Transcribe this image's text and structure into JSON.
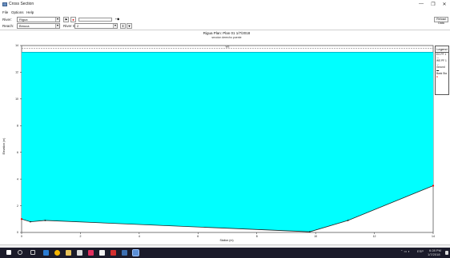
{
  "window": {
    "title": "Cross Section",
    "minimize": "—",
    "maximize": "❐",
    "close": "✕"
  },
  "menu": [
    "File",
    "Options",
    "Help"
  ],
  "toolbar": {
    "river_label": "River:",
    "river_value": "Rigua",
    "reach_label": "Reach:",
    "reach_value": "Bmuca",
    "station_label": "River Sta.:",
    "station_value": "2",
    "reload_label": "Reload Data"
  },
  "chart_data": {
    "type": "area",
    "title": "Rigua     Plan: Plan 01     1/7/2018",
    "subtitle": "seccion derecho puente",
    "xlabel": "Station (m)",
    "ylabel": "Elevation (m)",
    "xlim": [
      0,
      14
    ],
    "ylim": [
      0,
      14
    ],
    "xticks": [
      "0",
      "2",
      "4",
      "6",
      "8",
      "10",
      "12",
      "14"
    ],
    "yticks": [
      "0",
      "2",
      "4",
      "6",
      "8",
      "10",
      "12",
      "14"
    ],
    "water_surface_elevation": 13.5,
    "water_label": "WS",
    "ground": {
      "x": [
        0,
        0.3,
        0.8,
        9.8,
        11.1,
        14
      ],
      "y": [
        1.0,
        0.8,
        0.9,
        0.05,
        0.9,
        3.5
      ]
    },
    "bank_stations": {
      "x": [
        0,
        14
      ],
      "y": [
        1.0,
        3.5
      ]
    },
    "grid": false,
    "legend_placement": "right",
    "legend": [
      "Legend",
      "EG PF 1",
      "WS PF 1",
      "Ground",
      "Bank Sta"
    ],
    "colors": {
      "water": "#00FFFF",
      "ground": "#222222",
      "bank": "#ff0000",
      "eg": "#444444"
    }
  },
  "taskbar": {
    "time": "6:28 PM",
    "date": "1/7/2018",
    "lang": "ESP"
  }
}
